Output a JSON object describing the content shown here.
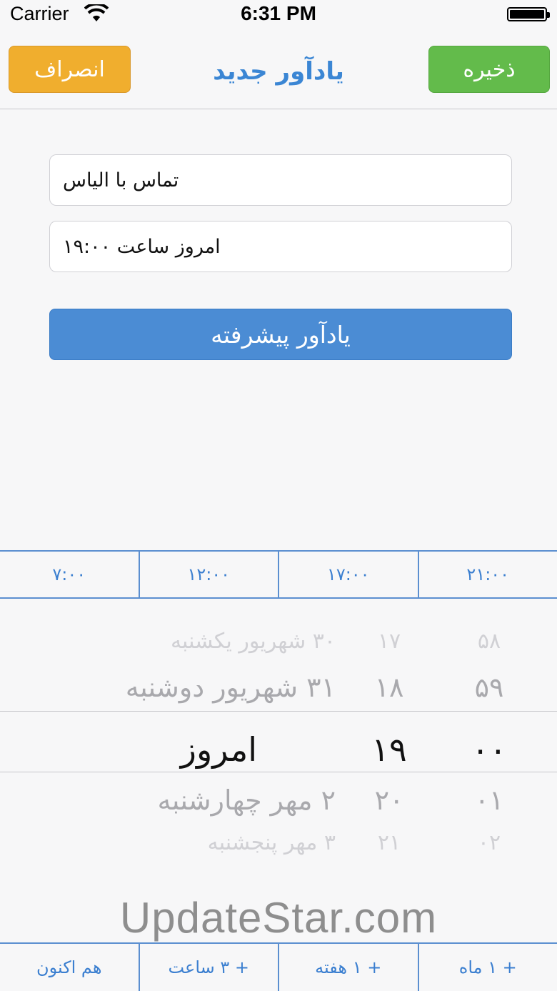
{
  "status_bar": {
    "carrier": "Carrier",
    "time": "6:31 PM",
    "wifi_icon": "wifi-icon",
    "battery_icon": "battery-icon",
    "battery_level": 1.0
  },
  "nav": {
    "save_label": "ذخیره",
    "title": "یادآور جدید",
    "cancel_label": "انصراف"
  },
  "form": {
    "title_value": "تماس با الیاس",
    "time_value": "امروز ساعت ۱۹:۰۰",
    "advanced_label": "یادآور پیشرفته"
  },
  "quick_times": [
    "۷:۰۰",
    "۱۲:۰۰",
    "۱۷:۰۰",
    "۲۱:۰۰"
  ],
  "picker": {
    "rows": [
      {
        "day": "۳۰ شهریور یکشنبه",
        "hour": "۱۷",
        "minute": "۵۸"
      },
      {
        "day": "۳۱ شهریور دوشنبه",
        "hour": "۱۸",
        "minute": "۵۹"
      },
      {
        "day": "امروز",
        "hour": "۱۹",
        "minute": "۰۰"
      },
      {
        "day": "۲ مهر چهارشنبه",
        "hour": "۲۰",
        "minute": "۰۱"
      },
      {
        "day": "۳ مهر پنجشنبه",
        "hour": "۲۱",
        "minute": "۰۲"
      }
    ]
  },
  "quick_offsets": [
    "هم اکنون",
    "+ ۳ ساعت",
    "+ ۱ هفته",
    "+ ۱ ماه"
  ],
  "watermark": "UpdateStar.com",
  "colors": {
    "save": "#63bb4b",
    "cancel": "#f0ae2e",
    "accent": "#3b86d4",
    "advanced": "#4b8cd4"
  }
}
